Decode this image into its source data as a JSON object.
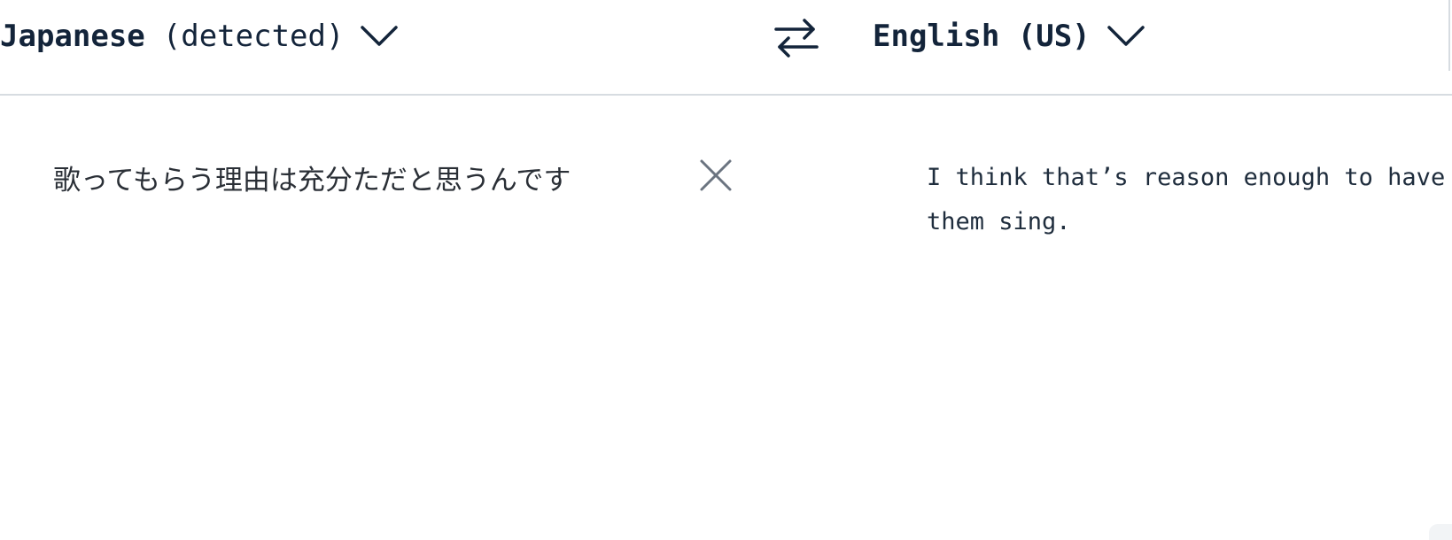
{
  "source_language": {
    "name": "Japanese",
    "status": "(detected)",
    "chevron_icon": "chevron-down-icon"
  },
  "target_language": {
    "name": "English (US)",
    "chevron_icon": "chevron-down-icon"
  },
  "swap_icon": "swap-arrows-icon",
  "source_text": "歌ってもらう理由は充分ただと思うんです",
  "clear_icon": "close-icon",
  "translation": {
    "line1": "I think that’s reason enough to have",
    "line2": "them sing."
  },
  "colors": {
    "text_primary": "#13243a",
    "divider": "#d7dce1",
    "icon_gray": "#6b7480"
  }
}
